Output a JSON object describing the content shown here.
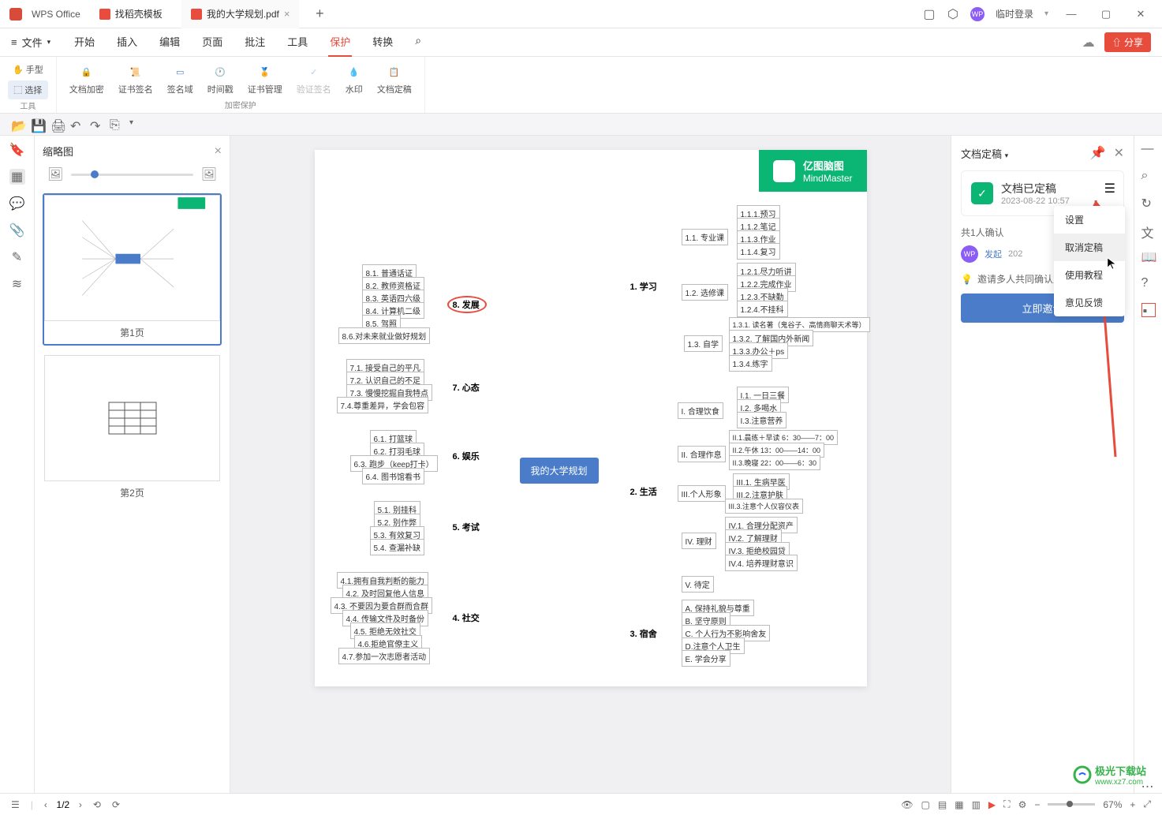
{
  "app": {
    "name": "WPS Office"
  },
  "tabs": [
    {
      "label": "找稻壳模板"
    },
    {
      "label": "我的大学规划.pdf",
      "active": true
    }
  ],
  "login": "临时登录",
  "file_menu": "文件",
  "menu": [
    "开始",
    "插入",
    "编辑",
    "页面",
    "批注",
    "工具",
    "保护",
    "转换"
  ],
  "menu_active": "保护",
  "share": "分享",
  "ribbon": {
    "tool_group": "工具",
    "hand": "手型",
    "select": "选择",
    "encrypt_group": "加密保护",
    "items": [
      "文档加密",
      "证书签名",
      "签名域",
      "时间戳",
      "证书管理",
      "验证签名",
      "水印",
      "文档定稿"
    ]
  },
  "thumb": {
    "title": "缩略图",
    "p1": "第1页",
    "p2": "第2页"
  },
  "mindmap": {
    "brand": "亿图脑图",
    "brand_en": "MindMaster",
    "center": "我的大学规划",
    "l_branches": [
      "8. 发展",
      "7. 心态",
      "6. 娱乐",
      "5. 考试",
      "4. 社交"
    ],
    "r_branches": [
      "1. 学习",
      "2. 生活",
      "3. 宿舍"
    ],
    "l8": [
      "8.1. 普通话证",
      "8.2. 教师资格证",
      "8.3. 英语四六级",
      "8.4. 计算机二级",
      "8.5. 驾照",
      "8.6.对未来就业做好规划"
    ],
    "l7": [
      "7.1. 接受自己的平凡",
      "7.2. 认识自己的不足",
      "7.3. 慢慢挖掘自我特点",
      "7.4.尊重差异，学会包容"
    ],
    "l6": [
      "6.1. 打篮球",
      "6.2. 打羽毛球",
      "6.3. 跑步（keep打卡）",
      "6.4. 图书馆看书"
    ],
    "l5": [
      "5.1. 别挂科",
      "5.2. 别作弊",
      "5.3. 有效复习",
      "5.4. 查漏补缺"
    ],
    "l4": [
      "4.1.拥有自我判断的能力",
      "4.2. 及时回复他人信息",
      "4.3. 不要因为要合群而合群",
      "4.4. 传输文件及时备份",
      "4.5. 拒绝无效社交",
      "4.6.拒绝官僚主义",
      "4.7.参加一次志愿者活动"
    ],
    "r1_sub": [
      "1.1. 专业课",
      "1.2. 选修课",
      "1.3. 自学"
    ],
    "r11": [
      "1.1.1.预习",
      "1.1.2.笔记",
      "1.1.3.作业",
      "1.1.4.复习"
    ],
    "r12": [
      "1.2.1.尽力听讲",
      "1.2.2.完成作业",
      "1.2.3.不缺勤",
      "1.2.4.不挂科"
    ],
    "r13": [
      "1.3.1. 读名著（鬼谷子、高情商聊天术等）",
      "1.3.2. 了解国内外新闻",
      "1.3.3.办公＋ps",
      "1.3.4.练字"
    ],
    "r2_sub": [
      "I. 合理饮食",
      "II. 合理作息",
      "III.个人形象",
      "IV. 理财",
      "V. 待定"
    ],
    "r2_I": [
      "I.1. 一日三餐",
      "I.2. 多喝水",
      "I.3.注意营养"
    ],
    "r2_II": [
      "II.1.晨练＋早读 6：30——7：00",
      "II.2.午休 13：00——14：00",
      "II.3.晚寝 22：00——6：30"
    ],
    "r2_III": [
      "III.1. 生病早医",
      "III.2.注意护肤",
      "III.3.注意个人仪容仪表"
    ],
    "r2_IV": [
      "IV.1. 合理分配资产",
      "IV.2. 了解理财",
      "IV.3. 拒绝校园贷",
      "IV.4. 培养理财意识"
    ],
    "r3": [
      "A. 保持礼貌与尊重",
      "B. 坚守原则",
      "C. 个人行为不影响舍友",
      "D.注意个人卫生",
      "E. 学会分享"
    ]
  },
  "panel": {
    "title": "文档定稿",
    "card_title": "文档已定稿",
    "card_date": "2023-08-22 10:57",
    "confirm": "共1人确认",
    "user": "WP",
    "start": "发起",
    "date_short": "202",
    "invite_tip": "邀请多人共同确认定稿",
    "invite_btn": "立即邀请"
  },
  "dropdown": [
    "设置",
    "取消定稿",
    "使用教程",
    "意见反馈"
  ],
  "status": {
    "page": "1/2",
    "zoom": "67%"
  },
  "watermark": {
    "t1": "极光下载站",
    "t2": "www.xz7.com"
  }
}
